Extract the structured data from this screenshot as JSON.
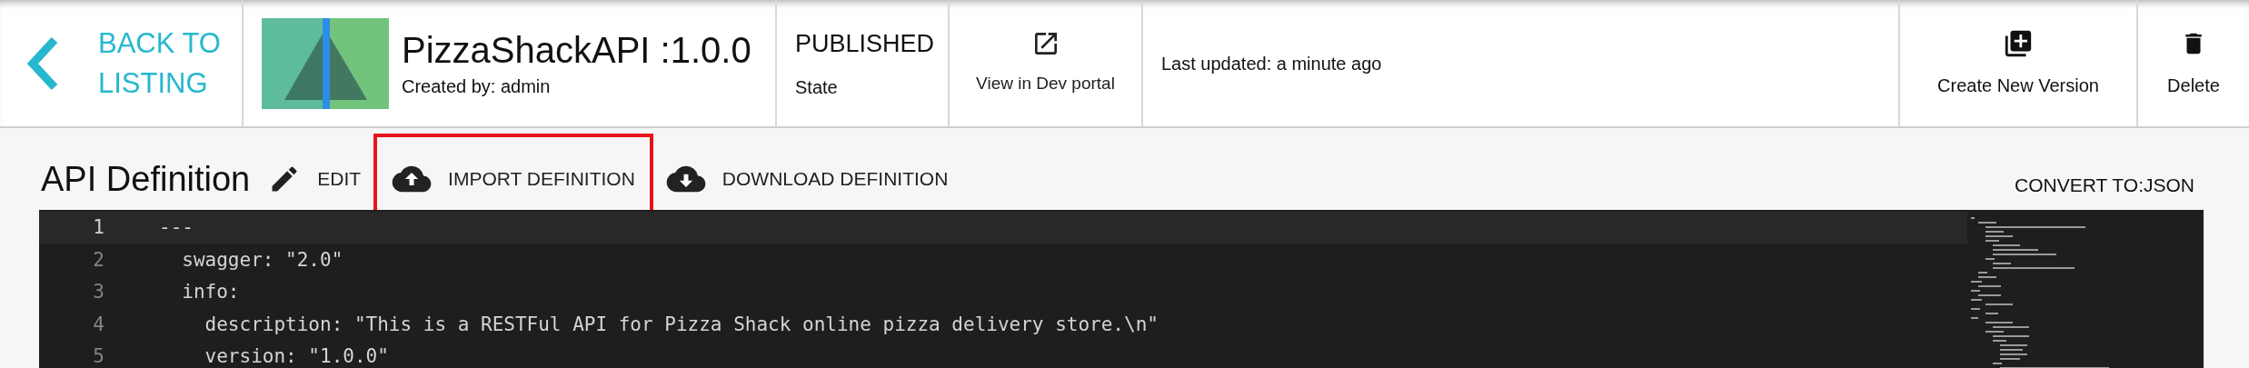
{
  "header": {
    "back": {
      "label_lines": [
        "BACK TO",
        "LISTING"
      ]
    },
    "api": {
      "name": "PizzaShackAPI :1.0.0",
      "created_by": "Created by: admin"
    },
    "state": {
      "value": "PUBLISHED",
      "label": "State"
    },
    "dev_portal": {
      "label": "View in Dev portal"
    },
    "last_updated": "Last updated: a minute ago",
    "actions": [
      {
        "kind": "create",
        "label": "Create New Version"
      },
      {
        "kind": "delete",
        "label": "Delete"
      }
    ]
  },
  "toolbar": {
    "title": "API Definition",
    "actions": [
      {
        "kind": "edit",
        "label": "EDIT",
        "highlighted": false
      },
      {
        "kind": "import",
        "label": "IMPORT DEFINITION",
        "highlighted": true
      },
      {
        "kind": "download",
        "label": "DOWNLOAD DEFINITION",
        "highlighted": false
      }
    ],
    "convert": "CONVERT TO:JSON"
  },
  "editor": {
    "lines": [
      {
        "number": "1",
        "text": "---",
        "current": true
      },
      {
        "number": "2",
        "text": "  swagger: \"2.0\"",
        "current": false
      },
      {
        "number": "3",
        "text": "  info:",
        "current": false
      },
      {
        "number": "4",
        "text": "    description: \"This is a RESTFul API for Pizza Shack online pizza delivery store.\\n\"",
        "current": false
      },
      {
        "number": "5",
        "text": "    version: \"1.0.0\"",
        "current": false
      }
    ]
  }
}
